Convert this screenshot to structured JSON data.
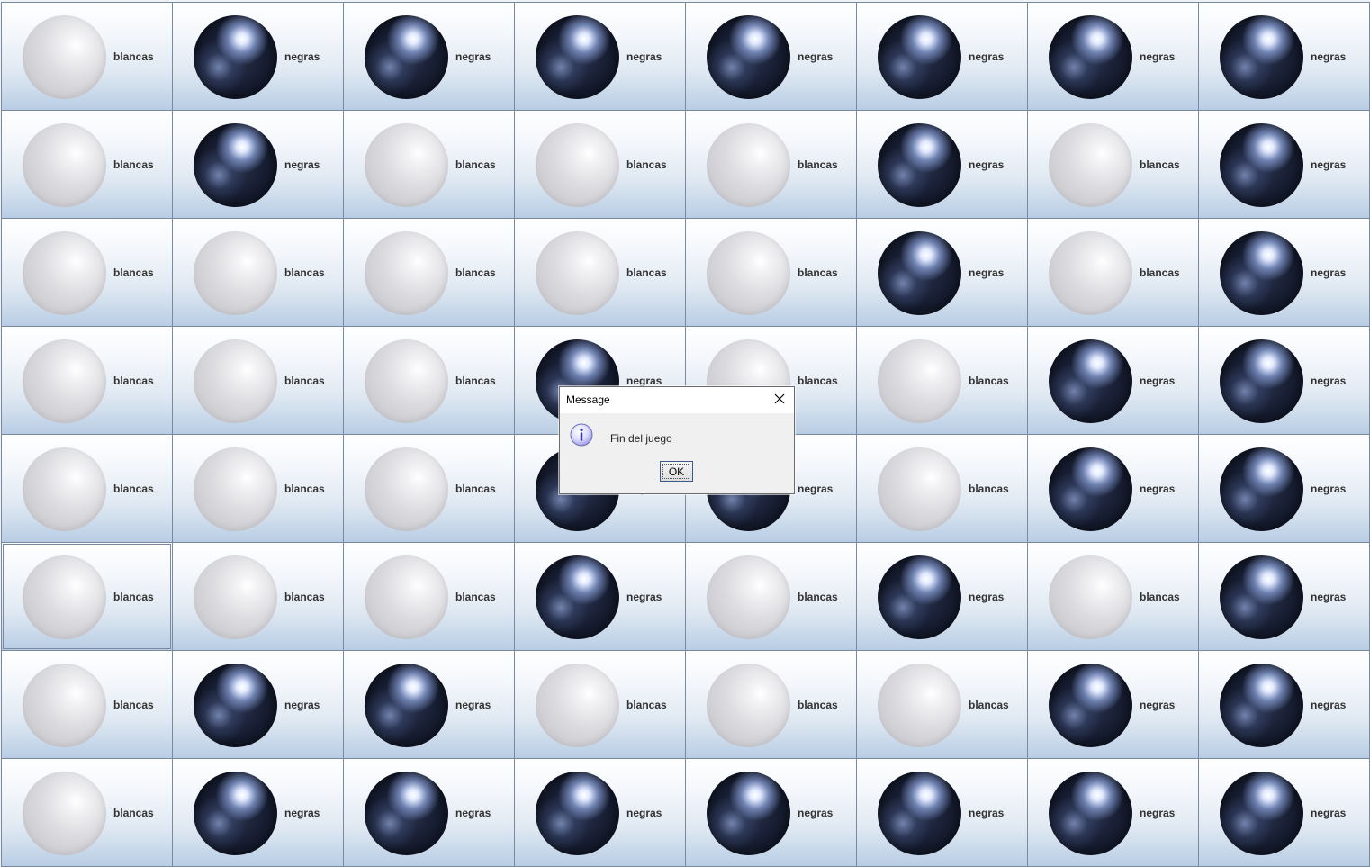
{
  "board": {
    "rows": [
      [
        "blancas",
        "negras",
        "negras",
        "negras",
        "negras",
        "negras",
        "negras",
        "negras"
      ],
      [
        "blancas",
        "negras",
        "blancas",
        "blancas",
        "blancas",
        "negras",
        "blancas",
        "negras"
      ],
      [
        "blancas",
        "blancas",
        "blancas",
        "blancas",
        "blancas",
        "negras",
        "blancas",
        "negras"
      ],
      [
        "blancas",
        "blancas",
        "blancas",
        "negras",
        "blancas",
        "blancas",
        "negras",
        "negras"
      ],
      [
        "blancas",
        "blancas",
        "blancas",
        "negras",
        "negras",
        "blancas",
        "negras",
        "negras"
      ],
      [
        "blancas",
        "blancas",
        "blancas",
        "negras",
        "blancas",
        "negras",
        "blancas",
        "negras"
      ],
      [
        "blancas",
        "negras",
        "negras",
        "blancas",
        "blancas",
        "blancas",
        "negras",
        "negras"
      ],
      [
        "blancas",
        "negras",
        "negras",
        "negras",
        "negras",
        "negras",
        "negras",
        "negras"
      ]
    ],
    "focused_cell": [
      5,
      0
    ]
  },
  "dialog": {
    "title": "Message",
    "message": "Fin del juego",
    "ok_label": "OK",
    "icon": "info-icon"
  }
}
